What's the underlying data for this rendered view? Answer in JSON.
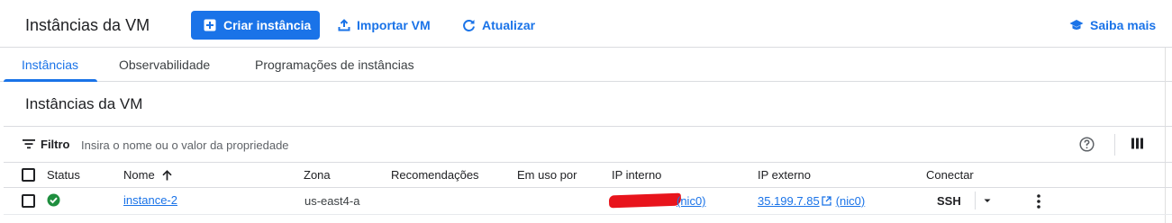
{
  "header": {
    "title": "Instâncias da VM",
    "create_button": "Criar instância",
    "import_button": "Importar VM",
    "refresh_button": "Atualizar",
    "learn_more": "Saiba mais"
  },
  "tabs": [
    {
      "label": "Instâncias",
      "active": true
    },
    {
      "label": "Observabilidade",
      "active": false
    },
    {
      "label": "Programações de instâncias",
      "active": false
    }
  ],
  "section": {
    "title": "Instâncias da VM"
  },
  "filter": {
    "label": "Filtro",
    "placeholder": "Insira o nome ou o valor da propriedade"
  },
  "table": {
    "columns": {
      "status": "Status",
      "name": "Nome",
      "zone": "Zona",
      "recommendations": "Recomendações",
      "in_use_by": "Em uso por",
      "internal_ip": "IP interno",
      "external_ip": "IP externo",
      "connect": "Conectar"
    },
    "rows": [
      {
        "status": "running",
        "name": "instance-2",
        "zone": "us-east4-a",
        "recommendations": "",
        "in_use_by": "",
        "internal_ip_nic": "(nic0)",
        "external_ip": "35.199.7.85",
        "external_ip_nic": "(nic0)",
        "connect": "SSH"
      }
    ]
  },
  "colors": {
    "accent": "#1a73e8",
    "status_ok": "#1e8e3e",
    "redaction": "#e8141c"
  },
  "icons": {
    "create": "add-box-icon",
    "import": "upload-icon",
    "refresh": "refresh-icon",
    "learn_more": "school-icon",
    "filter": "filter-list-icon",
    "help": "help-circle-icon",
    "columns": "view-column-icon",
    "sort": "arrow-up-icon",
    "status": "check-circle-icon",
    "external": "open-in-new-icon",
    "menu": "more-vert-icon"
  }
}
